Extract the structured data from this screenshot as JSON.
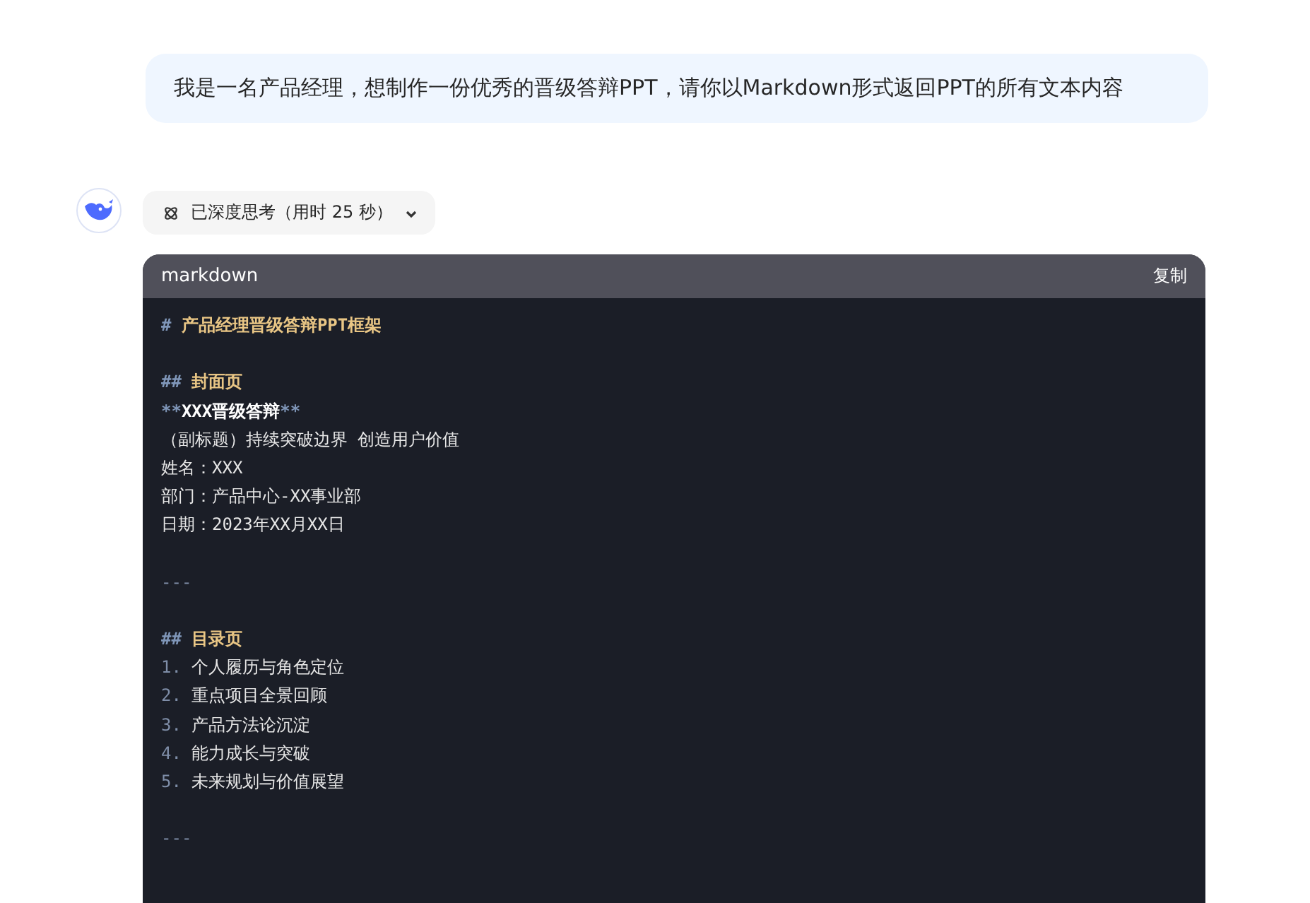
{
  "user_message": {
    "text": "我是一名产品经理，想制作一份优秀的晋级答辩PPT，请你以Markdown形式返回PPT的所有文本内容"
  },
  "thinking": {
    "label": "已深度思考（用时 25 秒）",
    "expanded": false
  },
  "code_block": {
    "language": "markdown",
    "copy_label": "复制",
    "lines": [
      [
        {
          "kind": "heading-mark",
          "text": "#"
        },
        {
          "kind": "heading-text",
          "text": " 产品经理晋级答辩PPT框架"
        }
      ],
      [
        {
          "kind": "blank"
        }
      ],
      [
        {
          "kind": "heading-mark",
          "text": "##"
        },
        {
          "kind": "heading-text",
          "text": " 封面页"
        }
      ],
      [
        {
          "kind": "bold-mark",
          "text": "**"
        },
        {
          "kind": "bold-text",
          "text": "XXX晋级答辩"
        },
        {
          "kind": "bold-mark",
          "text": "**"
        }
      ],
      [
        {
          "kind": "plain",
          "text": "（副标题）持续突破边界 创造用户价值"
        }
      ],
      [
        {
          "kind": "plain",
          "text": "姓名：XXX"
        }
      ],
      [
        {
          "kind": "plain",
          "text": "部门：产品中心-XX事业部"
        }
      ],
      [
        {
          "kind": "plain",
          "text": "日期：2023年XX月XX日"
        }
      ],
      [
        {
          "kind": "blank"
        }
      ],
      [
        {
          "kind": "rule",
          "text": "---"
        }
      ],
      [
        {
          "kind": "blank"
        }
      ],
      [
        {
          "kind": "heading-mark",
          "text": "##"
        },
        {
          "kind": "heading-text",
          "text": " 目录页"
        }
      ],
      [
        {
          "kind": "list-number",
          "text": "1."
        },
        {
          "kind": "plain",
          "text": " 个人履历与角色定位"
        }
      ],
      [
        {
          "kind": "list-number",
          "text": "2."
        },
        {
          "kind": "plain",
          "text": " 重点项目全景回顾"
        }
      ],
      [
        {
          "kind": "list-number",
          "text": "3."
        },
        {
          "kind": "plain",
          "text": " 产品方法论沉淀"
        }
      ],
      [
        {
          "kind": "list-number",
          "text": "4."
        },
        {
          "kind": "plain",
          "text": " 能力成长与突破"
        }
      ],
      [
        {
          "kind": "list-number",
          "text": "5."
        },
        {
          "kind": "plain",
          "text": " 未来规划与价值展望"
        }
      ],
      [
        {
          "kind": "blank"
        }
      ],
      [
        {
          "kind": "rule",
          "text": "---"
        }
      ]
    ]
  }
}
